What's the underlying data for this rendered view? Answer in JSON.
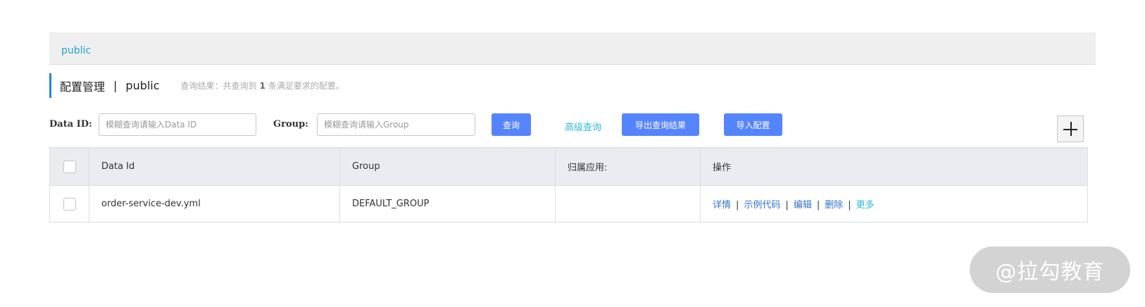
{
  "namespace_tabs": [
    {
      "label": "public"
    }
  ],
  "title": {
    "main": "配置管理",
    "separator": "|",
    "namespace": "public",
    "result_prefix": "查询结果：共查询到",
    "result_count": "1",
    "result_suffix": "条满足要求的配置。"
  },
  "search": {
    "data_id_label": "Data ID:",
    "data_id_placeholder": "模糊查询请输入Data ID",
    "group_label": "Group:",
    "group_placeholder": "模糊查询请输入Group",
    "query_button": "查询",
    "advanced_link": "高级查询",
    "export_button": "导出查询结果",
    "import_button": "导入配置"
  },
  "table": {
    "headers": [
      "Data Id",
      "Group",
      "归属应用:",
      "操作"
    ],
    "rows": [
      {
        "data_id": "order-service-dev.yml",
        "group": "DEFAULT_GROUP",
        "app": "",
        "actions": [
          "详情",
          "示例代码",
          "编辑",
          "删除",
          "更多"
        ]
      }
    ]
  },
  "watermark": "@拉勾教育",
  "colors": {
    "primary_button": "#5584ff",
    "link": "#2f74d0",
    "accent_link": "#2bbbd8",
    "title_bar": "#1f8bd1"
  }
}
